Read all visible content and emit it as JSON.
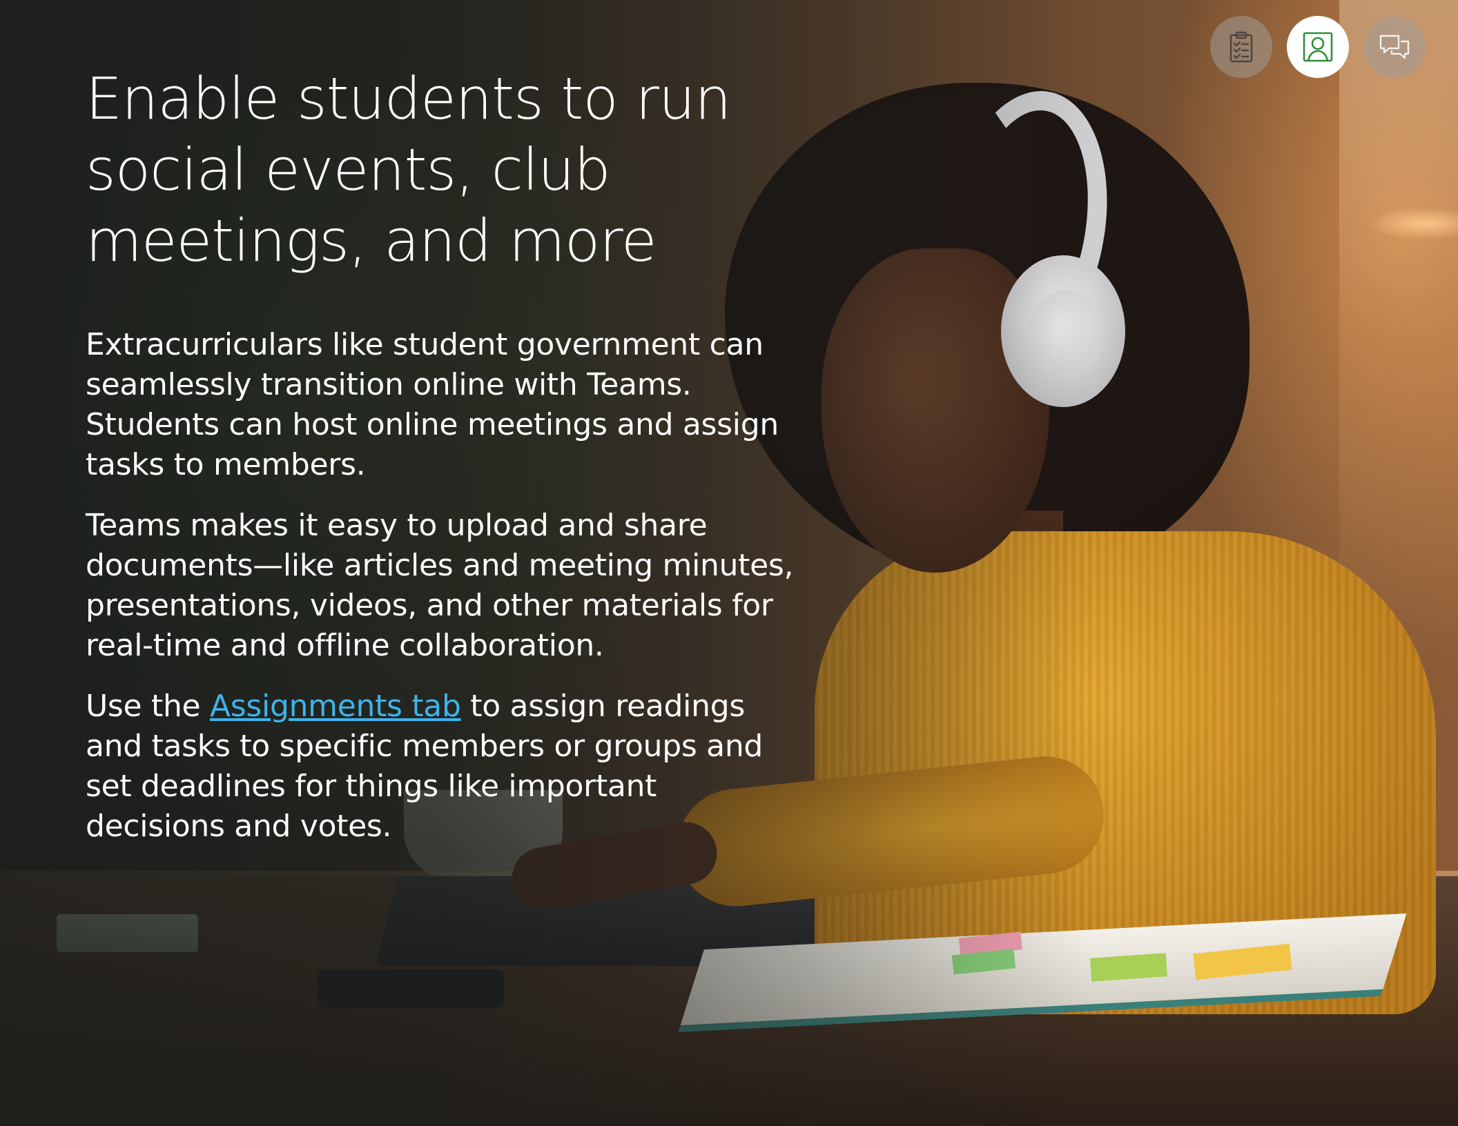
{
  "heading": {
    "title": "Enable students to run social events, club meetings, and more"
  },
  "body": {
    "para1": "Extracurriculars like student government can seamlessly transition online with Teams. Students can host online meetings and assign tasks to members.",
    "para2": "Teams makes it easy to upload and share documents—like articles and meeting minutes, presentations, videos, and other materials for real-time and offline collaboration.",
    "para3_prefix": "Use the ",
    "para3_link": "Assignments tab",
    "para3_suffix": " to assign readings and tasks to specific members or groups and set deadlines for things like important decisions and votes."
  },
  "nav": {
    "items": [
      {
        "icon": "clipboard-checklist-icon",
        "active": false
      },
      {
        "icon": "person-presenter-icon",
        "active": true
      },
      {
        "icon": "chat-bubbles-icon",
        "active": false
      }
    ]
  },
  "colors": {
    "link": "#3fb3ea",
    "active_icon": "#2f8f3a",
    "text": "#ffffff"
  }
}
